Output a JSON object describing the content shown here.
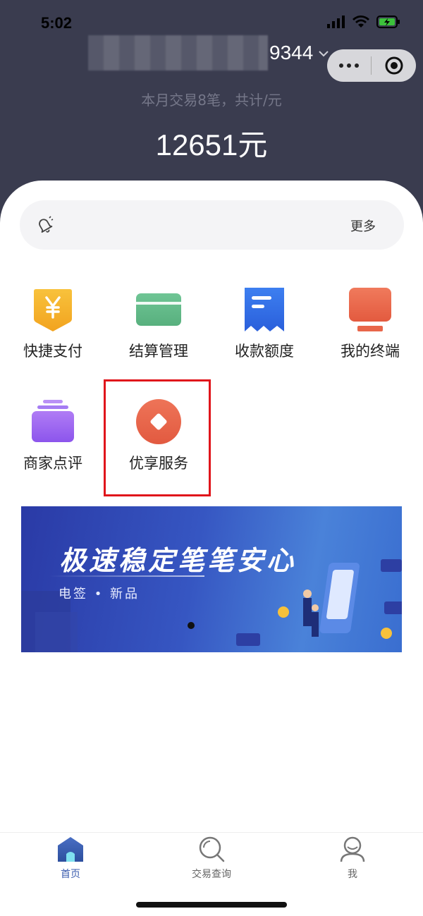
{
  "status_bar": {
    "time": "5:02"
  },
  "header": {
    "account_suffix": "9344",
    "summary": "本月交易8笔，共计/元",
    "amount": "12651元"
  },
  "notice": {
    "more": "更多"
  },
  "grid": {
    "items": [
      {
        "label": "快捷支付",
        "icon": "yen-shield-icon"
      },
      {
        "label": "结算管理",
        "icon": "card-icon"
      },
      {
        "label": "收款额度",
        "icon": "receipt-icon"
      },
      {
        "label": "我的终端",
        "icon": "terminal-icon"
      },
      {
        "label": "商家点评",
        "icon": "folder-stack-icon"
      },
      {
        "label": "优享服务",
        "icon": "diamond-circle-icon"
      }
    ]
  },
  "banner": {
    "title": "极速稳定笔笔安心",
    "subtitle": "电签 • 新品"
  },
  "tabbar": {
    "tabs": [
      {
        "label": "首页",
        "active": true,
        "icon": "home-icon"
      },
      {
        "label": "交易查询",
        "active": false,
        "icon": "search-icon"
      },
      {
        "label": "我",
        "active": false,
        "icon": "user-icon"
      }
    ]
  },
  "colors": {
    "header_bg": "#3a3c4f",
    "highlight_border": "#e0151b",
    "tab_active": "#3b5cae",
    "tab_inactive": "#666666"
  }
}
